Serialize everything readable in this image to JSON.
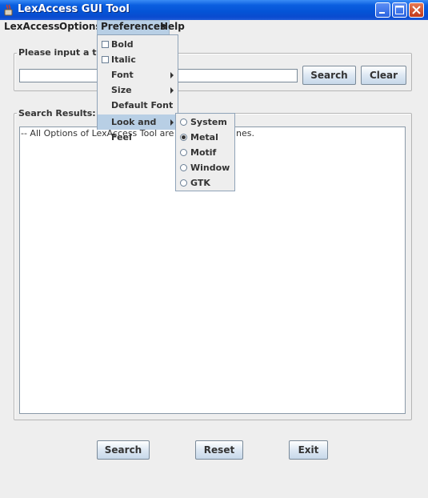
{
  "window": {
    "title": "LexAccess GUI Tool"
  },
  "menubar": {
    "items": [
      {
        "label": "LexAccess"
      },
      {
        "label": "Options"
      },
      {
        "label": "Preferences"
      },
      {
        "label": "Help"
      }
    ]
  },
  "preferences_menu": {
    "items": [
      {
        "label": "Bold",
        "checked": false
      },
      {
        "label": "Italic",
        "checked": false
      },
      {
        "label": "Font"
      },
      {
        "label": "Size"
      },
      {
        "label": "Default Font"
      },
      {
        "label": "Look and Feel"
      }
    ]
  },
  "look_and_feel_menu": {
    "items": [
      {
        "label": "System",
        "selected": false
      },
      {
        "label": "Metal",
        "selected": true
      },
      {
        "label": "Motif",
        "selected": false
      },
      {
        "label": "Window",
        "selected": false
      },
      {
        "label": "GTK",
        "selected": false
      }
    ]
  },
  "input_panel": {
    "label": "Please input a term",
    "term_value": "",
    "search_button": "Search",
    "clear_button": "Clear"
  },
  "results_panel": {
    "label": "Search Results:",
    "text_left": "-- All Options of LexAccess Tool are rese",
    "text_right": "nes."
  },
  "footer": {
    "search_button": "Search",
    "reset_button": "Reset",
    "exit_button": "Exit"
  },
  "colors": {
    "titlebar": "#0453d6",
    "menu_highlight": "#b8cfe5",
    "window_bg": "#eeeeee"
  }
}
